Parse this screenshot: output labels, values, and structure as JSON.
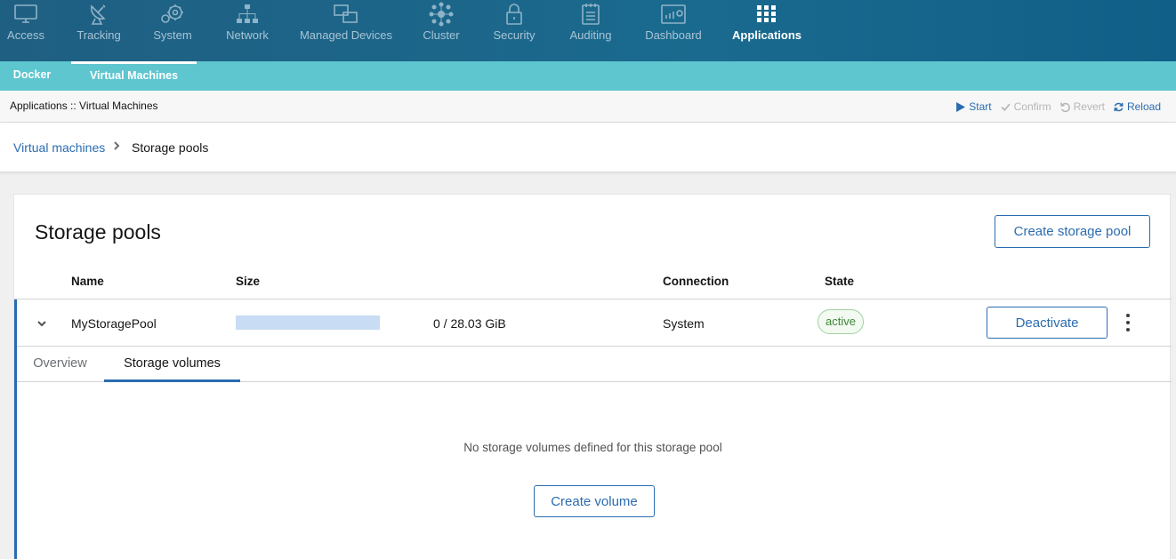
{
  "topnav": {
    "items": [
      {
        "label": "Access",
        "icon": "monitor-icon",
        "active": false
      },
      {
        "label": "Tracking",
        "icon": "satellite-dish-icon",
        "active": false
      },
      {
        "label": "System",
        "icon": "gears-icon",
        "active": false
      },
      {
        "label": "Network",
        "icon": "network-icon",
        "active": false
      },
      {
        "label": "Managed Devices",
        "icon": "devices-icon",
        "active": false
      },
      {
        "label": "Cluster",
        "icon": "cluster-icon",
        "active": false
      },
      {
        "label": "Security",
        "icon": "lock-icon",
        "active": false
      },
      {
        "label": "Auditing",
        "icon": "notepad-icon",
        "active": false
      },
      {
        "label": "Dashboard",
        "icon": "dashboard-icon",
        "active": false
      },
      {
        "label": "Applications",
        "icon": "grid-icon",
        "active": true
      }
    ]
  },
  "subnav": {
    "items": [
      {
        "label": "Docker",
        "active": false
      },
      {
        "label": "Virtual Machines",
        "active": true
      }
    ]
  },
  "appbar": {
    "path": "Applications :: Virtual Machines",
    "actions": {
      "start": "Start",
      "confirm": "Confirm",
      "revert": "Revert",
      "reload": "Reload"
    }
  },
  "breadcrumb": {
    "parent": "Virtual machines",
    "current": "Storage pools"
  },
  "card": {
    "title": "Storage pools",
    "create_button": "Create storage pool",
    "columns": {
      "name": "Name",
      "size": "Size",
      "connection": "Connection",
      "state": "State"
    },
    "pool": {
      "name": "MyStoragePool",
      "usage_fraction": 0,
      "size_text": "0 / 28.03 GiB",
      "connection": "System",
      "state": "active",
      "action_button": "Deactivate"
    },
    "tabs": [
      {
        "label": "Overview",
        "active": false
      },
      {
        "label": "Storage volumes",
        "active": true
      }
    ],
    "empty_message": "No storage volumes defined for this storage pool",
    "create_volume_button": "Create volume"
  },
  "colors": {
    "nav_bg": "#1a6a8f",
    "subnav_bg": "#5ec6cf",
    "link_blue": "#2b6cb0",
    "state_green": "#3e8635"
  }
}
